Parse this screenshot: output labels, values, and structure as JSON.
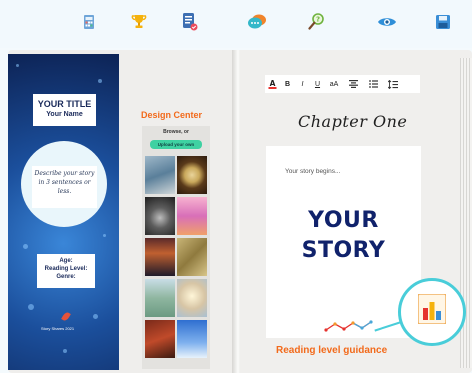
{
  "toolbar": {
    "icons": [
      "calculator-icon",
      "trophy-icon",
      "checklist-icon",
      "chat-icon",
      "magnifier-icon",
      "eye-icon",
      "save-icon"
    ]
  },
  "cover": {
    "title": "YOUR TITLE",
    "author": "Your Name",
    "description": "Describe your story in 3 sentences or less.",
    "meta_age": "Age:",
    "meta_level": "Reading Level:",
    "meta_genre": "Genre:",
    "footer": "Story Shares 2021"
  },
  "design_center": {
    "title": "Design Center",
    "browse": "Browse, or",
    "upload": "Upload your own"
  },
  "editor": {
    "format": {
      "bold": "B",
      "italic": "I",
      "underline": "U",
      "case": "aA"
    },
    "chapter_title": "Chapter One",
    "placeholder": "Your story begins...",
    "big_text_1": "YOUR",
    "big_text_2": "STORY",
    "guidance_label": "Reading level guidance"
  },
  "colors": {
    "accent_orange": "#f26a1b",
    "upload_green": "#3fd1a2",
    "navy": "#10226b",
    "teal": "#49cdd9"
  }
}
